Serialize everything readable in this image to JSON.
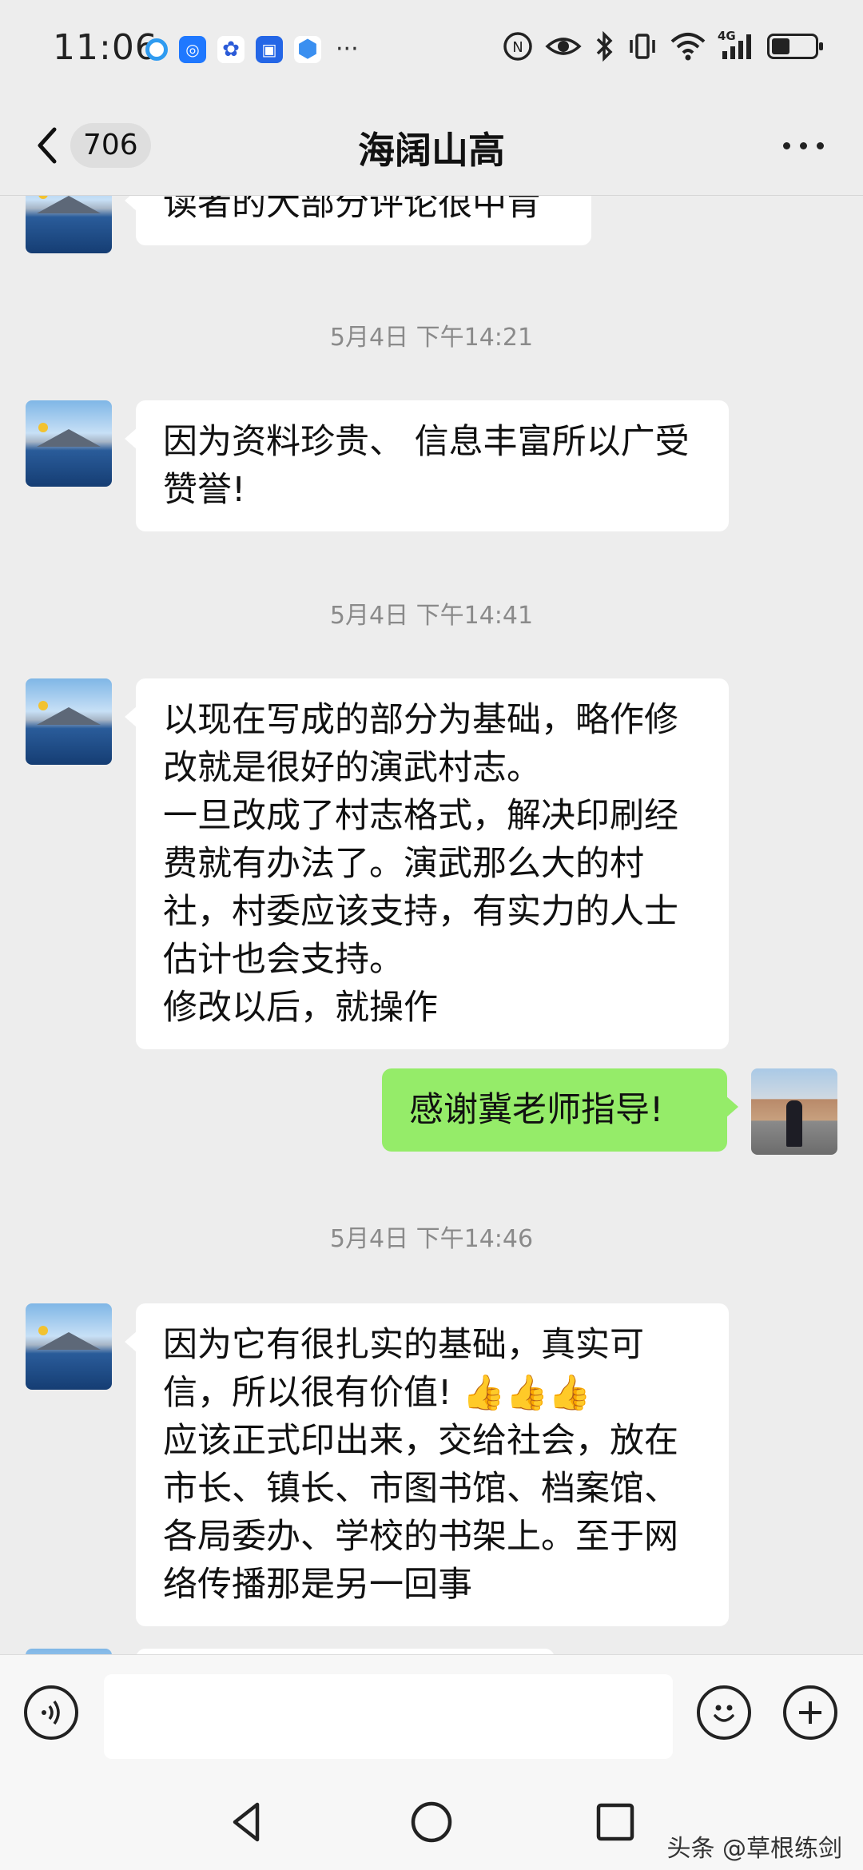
{
  "status_bar": {
    "time": "11:06",
    "more": "···",
    "network": "4G"
  },
  "nav": {
    "unread_count": "706",
    "title": "海阔山高"
  },
  "messages": [
    {
      "type": "text",
      "side": "left",
      "text": "读者的大部分评论很中肯"
    },
    {
      "type": "timestamp",
      "text": "5月4日 下午14:21"
    },
    {
      "type": "text",
      "side": "left",
      "text": "因为资料珍贵、 信息丰富所以广受赞誉!"
    },
    {
      "type": "timestamp",
      "text": "5月4日 下午14:41"
    },
    {
      "type": "text",
      "side": "left",
      "text": "以现在写成的部分为基础，略作修改就是很好的演武村志。\n一旦改成了村志格式，解决印刷经费就有办法了。演武那么大的村社，村委应该支持，有实力的人士估计也会支持。\n修改以后，就操作"
    },
    {
      "type": "text",
      "side": "right",
      "text": "感谢冀老师指导!"
    },
    {
      "type": "timestamp",
      "text": "5月4日 下午14:46"
    },
    {
      "type": "text",
      "side": "left",
      "text": "因为它有很扎实的基础，真实可信，所以很有价值! 👍👍👍\n应该正式印出来，交给社会，放在市长、镇长、市图书馆、档案馆、各局委办、学校的书架上。至于网络传播那是另一回事"
    }
  ],
  "input_bar": {
    "message_value": "",
    "voice_icon": "voice-icon",
    "emoji_icon": "emoji-icon",
    "plus_icon": "plus-icon"
  },
  "watermark": "头条 @草根练剑",
  "colors": {
    "background": "#ededed",
    "bubble_left": "#ffffff",
    "bubble_right": "#95ec69"
  }
}
